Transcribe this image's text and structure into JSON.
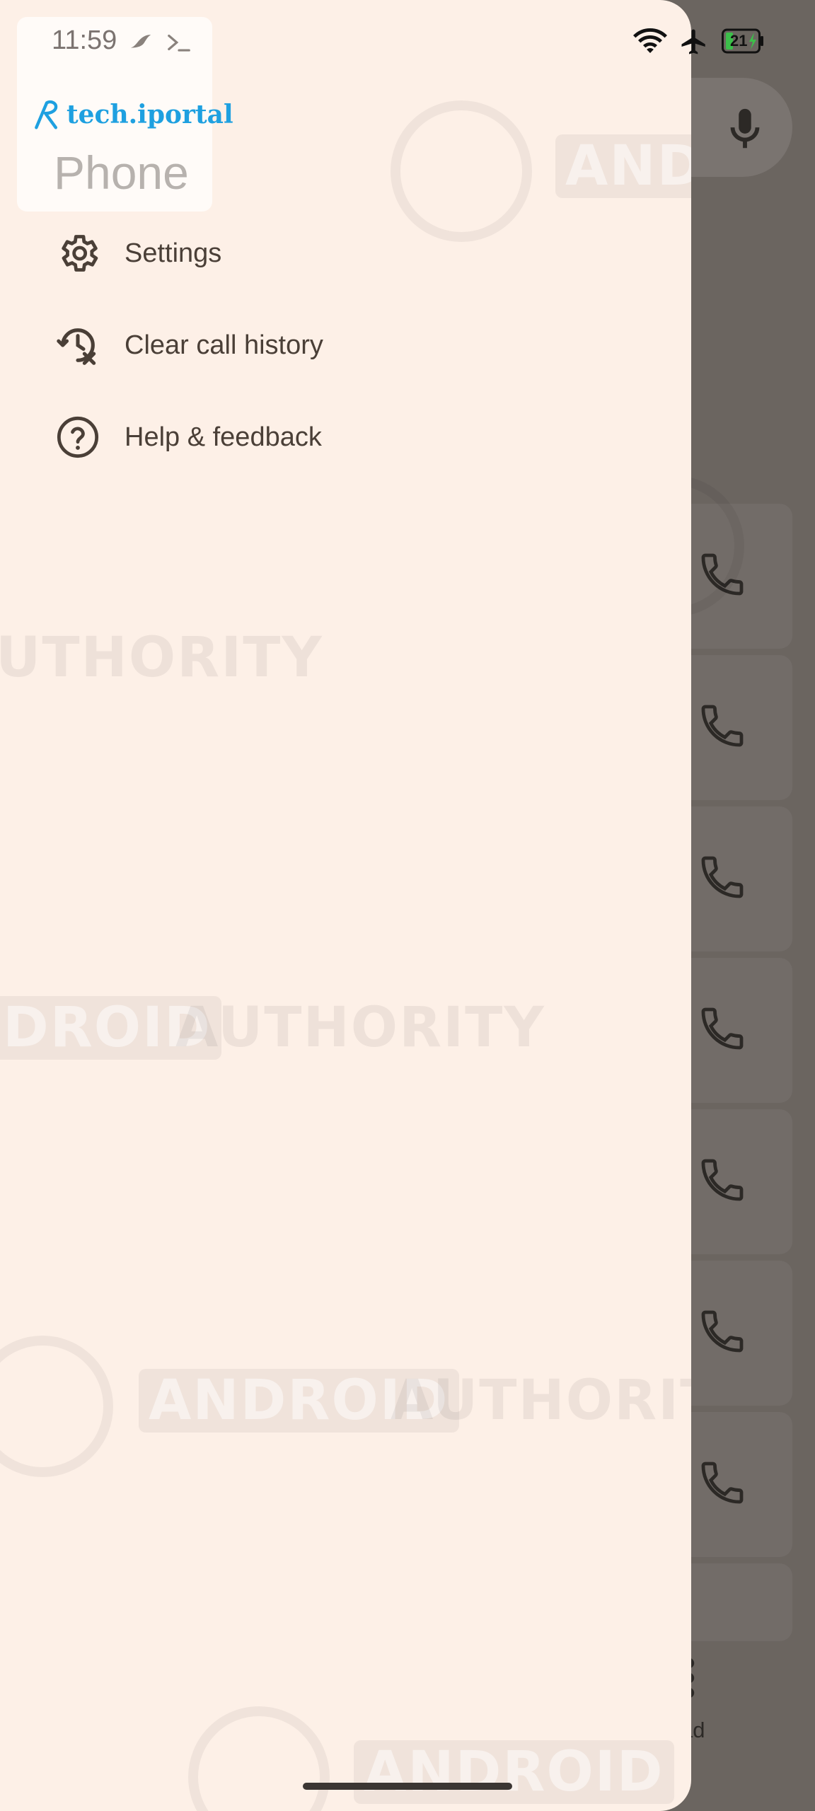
{
  "status_bar": {
    "time": "11:59",
    "battery_level": "21"
  },
  "header": {
    "brand": "tech.iportal",
    "app_title": "Phone"
  },
  "menu": {
    "items": [
      {
        "label": "Settings",
        "icon": "gear-icon"
      },
      {
        "label": "Clear call history",
        "icon": "history-clear-icon"
      },
      {
        "label": "Help & feedback",
        "icon": "help-icon"
      }
    ]
  },
  "watermark": {
    "word1": "ANDROID",
    "word2": "AUTHORITY",
    "fragment_left": "UTHORITY",
    "fragment_droid": "DROID"
  },
  "background": {
    "bottom_label": "ad"
  },
  "colors": {
    "drawer_bg": "#fdf0e7",
    "scrim": "#6b6560",
    "brand": "#1ea0e0",
    "menu_text": "#4a3f37"
  }
}
